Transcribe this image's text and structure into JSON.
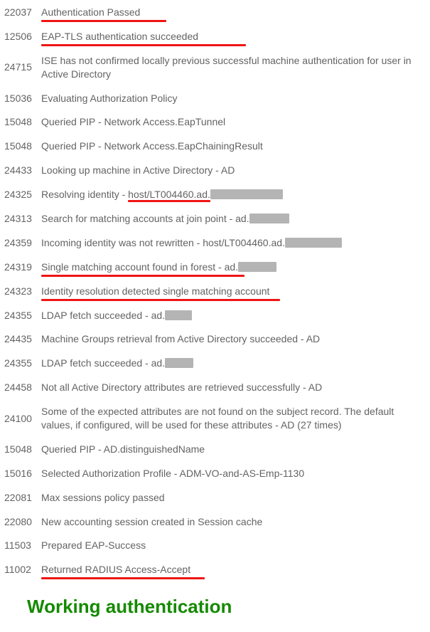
{
  "log": [
    {
      "code": "22037",
      "desc": "Authentication Passed",
      "underline": "ul-w1",
      "redact": null
    },
    {
      "code": "12506",
      "desc": "EAP-TLS authentication succeeded",
      "underline": "ul-w2",
      "redact": null
    },
    {
      "code": "24715",
      "desc": "ISE has not confirmed locally previous successful machine authentication for user in Active Directory",
      "underline": null,
      "redact": null
    },
    {
      "code": "15036",
      "desc": "Evaluating Authorization Policy",
      "underline": null,
      "redact": null
    },
    {
      "code": "15048",
      "desc": "Queried PIP - Network Access.EapTunnel",
      "underline": null,
      "redact": null
    },
    {
      "code": "15048",
      "desc": "Queried PIP - Network Access.EapChainingResult",
      "underline": null,
      "redact": null
    },
    {
      "code": "24433",
      "desc": "Looking up machine in Active Directory - AD",
      "underline": null,
      "redact": null
    },
    {
      "code": "24325",
      "desc_prefix": "Resolving identity - ",
      "underlined_text": "host/LT004460.ad.",
      "underline": "partial",
      "redact": "rw1"
    },
    {
      "code": "24313",
      "desc": "Search for matching accounts at join point - ad.",
      "underline": null,
      "redact": "rw2"
    },
    {
      "code": "24359",
      "desc": "Incoming identity was not rewritten - host/LT004460.ad.",
      "underline": null,
      "redact": "rw3"
    },
    {
      "code": "24319",
      "desc": "Single matching account found in forest - ad.",
      "underline": "ul-w4",
      "redact": "rw4"
    },
    {
      "code": "24323",
      "desc": "Identity resolution detected single matching account",
      "underline": "ul-w5",
      "redact": null
    },
    {
      "code": "24355",
      "desc": "LDAP fetch succeeded - ad.",
      "underline": null,
      "redact": "rw5"
    },
    {
      "code": "24435",
      "desc": "Machine Groups retrieval from Active Directory succeeded - AD",
      "underline": null,
      "redact": null
    },
    {
      "code": "24355",
      "desc": "LDAP fetch succeeded - ad.",
      "underline": null,
      "redact": "rw6"
    },
    {
      "code": "24458",
      "desc": "Not all Active Directory attributes are retrieved successfully - AD",
      "underline": null,
      "redact": null
    },
    {
      "code": "24100",
      "desc": "Some of the expected attributes are not found on the subject record. The default values, if configured, will be used for these attributes - AD (27 times)",
      "underline": null,
      "redact": null
    },
    {
      "code": "15048",
      "desc": "Queried PIP - AD.distinguishedName",
      "underline": null,
      "redact": null
    },
    {
      "code": "15016",
      "desc": "Selected Authorization Profile - ADM-VO-and-AS-Emp-1130",
      "underline": null,
      "redact": null
    },
    {
      "code": "22081",
      "desc": "Max sessions policy passed",
      "underline": null,
      "redact": null
    },
    {
      "code": "22080",
      "desc": "New accounting session created in Session cache",
      "underline": null,
      "redact": null
    },
    {
      "code": "11503",
      "desc": "Prepared EAP-Success",
      "underline": null,
      "redact": null
    },
    {
      "code": "11002",
      "desc": "Returned RADIUS Access-Accept",
      "underline": "ul-w6",
      "redact": null
    }
  ],
  "caption": "Working authentication"
}
